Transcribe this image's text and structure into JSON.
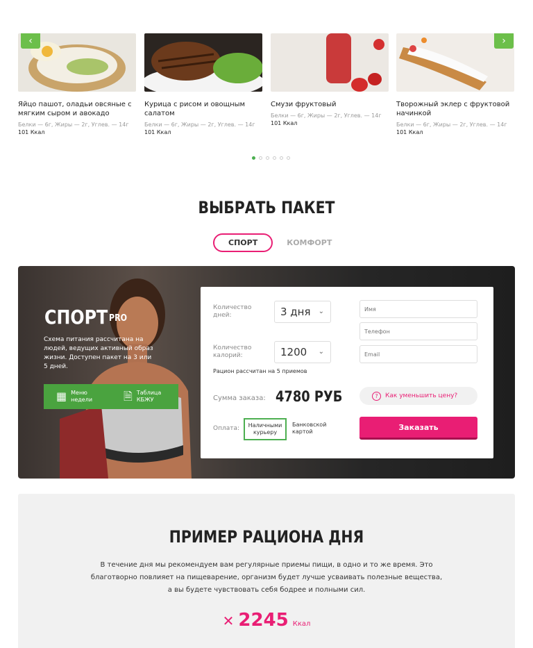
{
  "carousel": {
    "cards": [
      {
        "title": "Яйцо пашот, оладьи овсяные с мягким сыром и авокадо",
        "macros": "Белки — 6г, Жиры — 2г, Углев. — 14г",
        "kcal": "101 Ккал"
      },
      {
        "title": "Курица с рисом и овощным салатом",
        "macros": "Белки — 6г, Жиры — 2г, Углев. — 14г",
        "kcal": "101 Ккал"
      },
      {
        "title": "Смузи фруктовый",
        "macros": "Белки — 6г, Жиры — 2г, Углев. — 14г",
        "kcal": "101 Ккал"
      },
      {
        "title": "Творожный эклер с фруктовой начинкой",
        "macros": "Белки — 6г, Жиры — 2г, Углев. — 14г",
        "kcal": "101 Ккал"
      }
    ],
    "prev_icon": "chevron-left-icon",
    "next_icon": "chevron-right-icon",
    "dots_count": 6,
    "active_dot": 1
  },
  "package": {
    "title": "ВЫБРАТЬ ПАКЕТ",
    "tabs": [
      {
        "label": "СПОРТ",
        "active": true
      },
      {
        "label": "КОМФОРТ",
        "active": false
      }
    ],
    "promo": {
      "name": "СПОРТ",
      "badge": "PRO",
      "description": "Схема питания рассчитана на людей, ведущих активный образ жизни. Доступен пакет на 3 или 5 дней.",
      "menu_label_1": "Меню",
      "menu_label_2": "недели",
      "table_label_1": "Таблица",
      "table_label_2": "КБЖУ"
    },
    "form": {
      "days_label_1": "Количество",
      "days_label_2": "дней:",
      "days_value": "3 дня",
      "cal_label_1": "Количество",
      "cal_label_2": "калорий:",
      "cal_value": "1200",
      "note": "Рацион рассчитан на 5 приемов",
      "sum_label": "Сумма заказа:",
      "sum_value": "4780 РУБ",
      "pay_label": "Оплата:",
      "pay_cash_1": "Наличными",
      "pay_cash_2": "курьеру",
      "pay_card_1": "Банковской",
      "pay_card_2": "картой",
      "name_placeholder": "Имя",
      "phone_placeholder": "Телефон",
      "email_placeholder": "Email",
      "hint": "Как уменьшить цену?",
      "order_button": "Заказать"
    },
    "accent_color": "#e91e74",
    "green_color": "#4aa33f"
  },
  "ration": {
    "title": "ПРИМЕР РАЦИОНА ДНЯ",
    "text_1": "В течение дня мы рекомендуем вам регулярные приемы пищи, в одно и то же время. Это",
    "text_2": "благотворно повлияет на пищеварение, организм будет лучше усваивать полезные вещества,",
    "text_3": "а вы будете чувствовать себя бодрее и полными сил.",
    "kcal_value": "2245",
    "kcal_unit": "Ккал",
    "icon": "fork-knife-icon"
  }
}
